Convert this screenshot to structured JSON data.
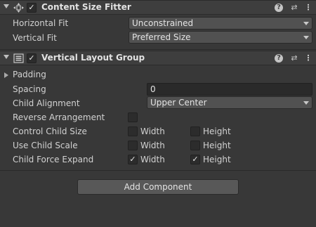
{
  "content_size_fitter": {
    "title": "Content Size Fitter",
    "enabled": true,
    "icons": {
      "component": "move-arrows-icon",
      "help": "help-icon",
      "preset": "preset-sliders-icon",
      "more": "more-vertical-icon"
    },
    "horizontal_fit": {
      "label": "Horizontal Fit",
      "value": "Unconstrained"
    },
    "vertical_fit": {
      "label": "Vertical Fit",
      "value": "Preferred Size"
    }
  },
  "vertical_layout_group": {
    "title": "Vertical Layout Group",
    "enabled": true,
    "icons": {
      "component": "layout-list-icon",
      "help": "help-icon",
      "preset": "preset-sliders-icon",
      "more": "more-vertical-icon"
    },
    "padding": {
      "label": "Padding"
    },
    "spacing": {
      "label": "Spacing",
      "value": "0"
    },
    "child_alignment": {
      "label": "Child Alignment",
      "value": "Upper Center"
    },
    "reverse_arrangement": {
      "label": "Reverse Arrangement",
      "checked": false
    },
    "control_child_size": {
      "label": "Control Child Size",
      "width_label": "Width",
      "height_label": "Height",
      "width": false,
      "height": false
    },
    "use_child_scale": {
      "label": "Use Child Scale",
      "width_label": "Width",
      "height_label": "Height",
      "width": false,
      "height": false
    },
    "child_force_expand": {
      "label": "Child Force Expand",
      "width_label": "Width",
      "height_label": "Height",
      "width": true,
      "height": true
    }
  },
  "add_component": {
    "label": "Add Component"
  },
  "glyphs": {
    "check": "✓",
    "help": "?",
    "preset": "⇄",
    "more": "⋮"
  }
}
